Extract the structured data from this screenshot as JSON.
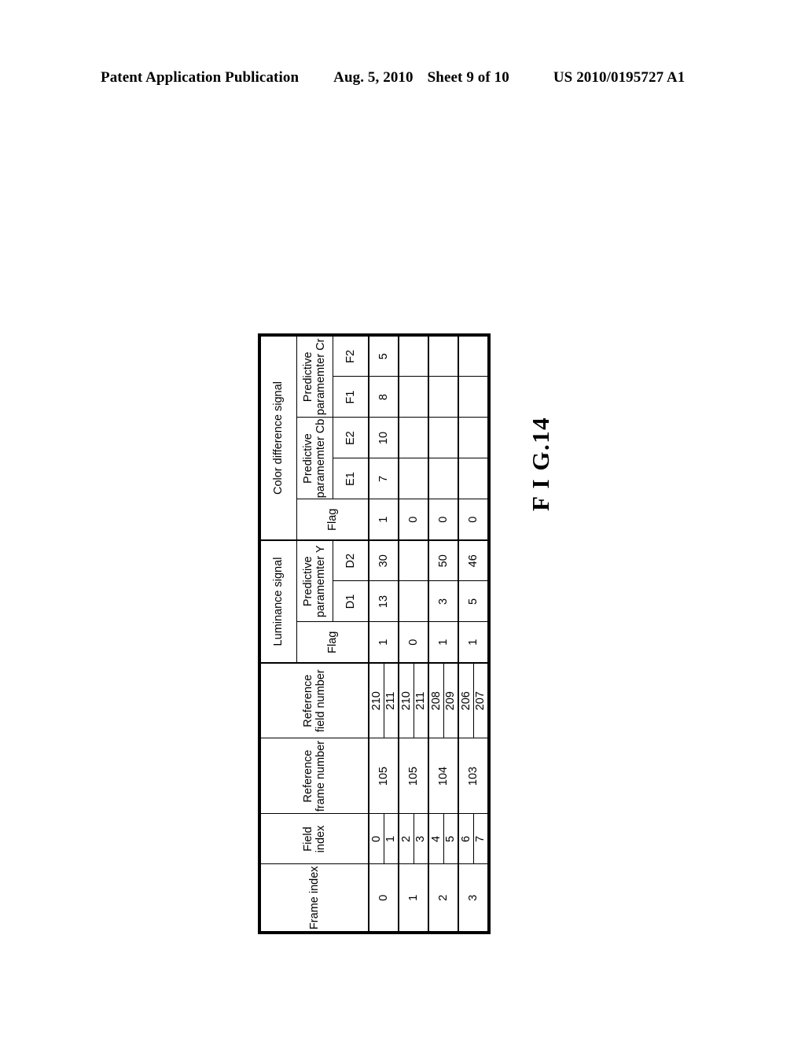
{
  "header": {
    "publication": "Patent Application Publication",
    "date": "Aug. 5, 2010",
    "sheet": "Sheet 9 of 10",
    "number": "US 2010/0195727 A1"
  },
  "figure": {
    "caption": "F I G.14",
    "rotation_degrees": -90
  },
  "table": {
    "columns": {
      "frame_index": "Frame index",
      "field_index": "Field index",
      "reference_frame_number": "Reference frame number",
      "reference_field_number": "Reference field number",
      "luminance_signal": "Luminance signal",
      "color_difference_signal": "Color difference signal",
      "flag": "Flag",
      "predictive_parameter_y": "Predictive paramemter Y",
      "predictive_parameter_cb": "Predictive paramemter Cb",
      "predictive_parameter_cr": "Predictive paramemter Cr",
      "sub_d1": "D1",
      "sub_d2": "D2",
      "sub_e1": "E1",
      "sub_e2": "E2",
      "sub_f1": "F1",
      "sub_f2": "F2"
    },
    "rows": [
      {
        "frame_index": "0",
        "field_index": [
          "0",
          "1"
        ],
        "reference_frame_number": "105",
        "reference_field_number": [
          "210",
          "211"
        ],
        "luma_flag": "1",
        "luma_d1": "13",
        "luma_d2": "30",
        "chroma_flag": "1",
        "cb_e1": "7",
        "cb_e2": "10",
        "cr_f1": "8",
        "cr_f2": "5"
      },
      {
        "frame_index": "1",
        "field_index": [
          "2",
          "3"
        ],
        "reference_frame_number": "105",
        "reference_field_number": [
          "210",
          "211"
        ],
        "luma_flag": "0",
        "luma_d1": "",
        "luma_d2": "",
        "chroma_flag": "0",
        "cb_e1": "",
        "cb_e2": "",
        "cr_f1": "",
        "cr_f2": ""
      },
      {
        "frame_index": "2",
        "field_index": [
          "4",
          "5"
        ],
        "reference_frame_number": "104",
        "reference_field_number": [
          "208",
          "209"
        ],
        "luma_flag": "1",
        "luma_d1": "3",
        "luma_d2": "50",
        "chroma_flag": "0",
        "cb_e1": "",
        "cb_e2": "",
        "cr_f1": "",
        "cr_f2": ""
      },
      {
        "frame_index": "3",
        "field_index": [
          "6",
          "7"
        ],
        "reference_frame_number": "103",
        "reference_field_number": [
          "206",
          "207"
        ],
        "luma_flag": "1",
        "luma_d1": "5",
        "luma_d2": "46",
        "chroma_flag": "0",
        "cb_e1": "",
        "cb_e2": "",
        "cr_f1": "",
        "cr_f2": ""
      }
    ]
  }
}
